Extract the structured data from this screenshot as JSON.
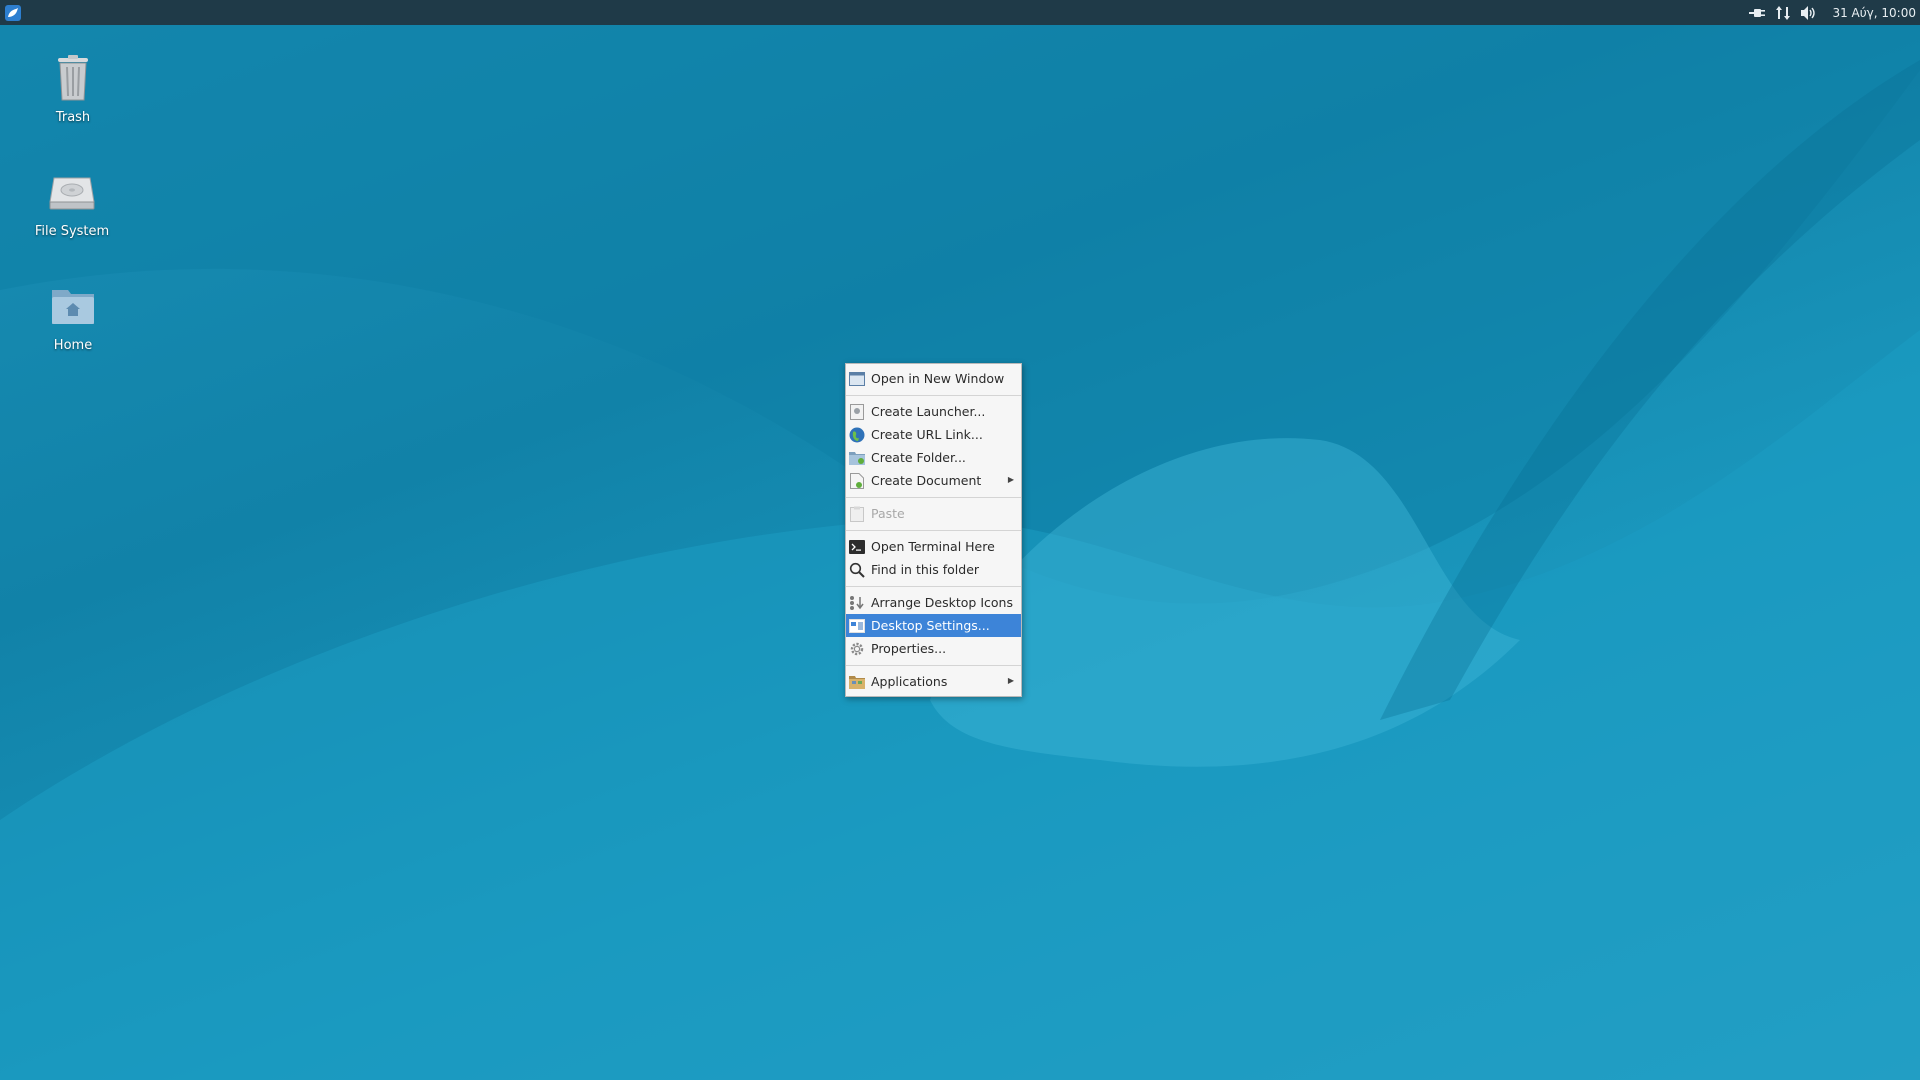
{
  "panel": {
    "clock": "31 Αύγ, 10:00",
    "tray_icons": [
      "power-plug-icon",
      "network-icon",
      "volume-icon"
    ]
  },
  "desktop_icons": [
    {
      "label": "Trash",
      "icon": "trash-icon"
    },
    {
      "label": "File System",
      "icon": "drive-icon"
    },
    {
      "label": "Home",
      "icon": "home-folder-icon"
    }
  ],
  "context_menu": {
    "items": [
      {
        "label": "Open in New Window",
        "icon": "window-icon"
      },
      {
        "label": "Create Launcher...",
        "icon": "launcher-icon"
      },
      {
        "label": "Create URL Link...",
        "icon": "globe-icon"
      },
      {
        "label": "Create Folder...",
        "icon": "folder-new-icon"
      },
      {
        "label": "Create Document",
        "icon": "document-new-icon",
        "submenu": true
      },
      {
        "label": "Paste",
        "icon": "paste-icon",
        "disabled": true
      },
      {
        "label": "Open Terminal Here",
        "icon": "terminal-icon"
      },
      {
        "label": "Find in this folder",
        "icon": "search-icon"
      },
      {
        "label": "Arrange Desktop Icons",
        "icon": "arrange-icon"
      },
      {
        "label": "Desktop Settings...",
        "icon": "desktop-settings-icon",
        "highlighted": true
      },
      {
        "label": "Properties...",
        "icon": "gear-icon"
      },
      {
        "label": "Applications",
        "icon": "applications-icon",
        "submenu": true
      }
    ]
  },
  "colors": {
    "panel_bg": "#1f3a48",
    "menu_highlight": "#3d84d8",
    "wallpaper": "#1a8fb6"
  }
}
